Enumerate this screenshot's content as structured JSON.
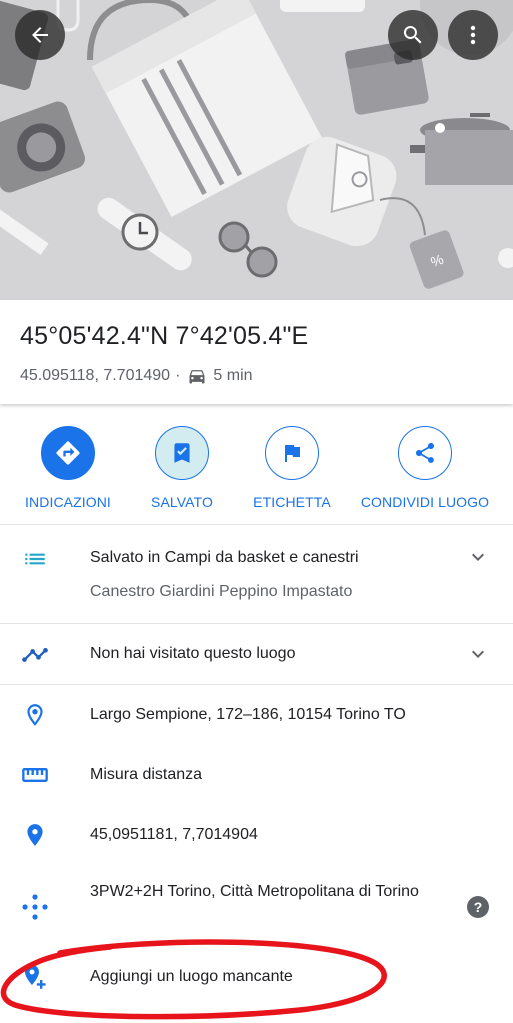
{
  "header": {
    "back_icon": "arrow-left-icon",
    "search_icon": "search-icon",
    "more_icon": "more-vert-icon"
  },
  "place": {
    "title": "45°05'42.4\"N 7°42'05.4\"E",
    "coords": "45.095118, 7.701490",
    "separator": "·",
    "travel_time": "5 min"
  },
  "actions": [
    {
      "label": "INDICAZIONI",
      "icon": "directions-icon"
    },
    {
      "label": "SALVATO",
      "icon": "bookmark-check-icon"
    },
    {
      "label": "ETICHETTA",
      "icon": "flag-icon"
    },
    {
      "label": "CONDIVIDI LUOGO",
      "icon": "share-icon"
    }
  ],
  "details": {
    "saved_list": "Salvato in Campi da basket e canestri",
    "saved_note": "Canestro Giardini Peppino Impastato",
    "visited": "Non hai visitato questo luogo",
    "address": "Largo Sempione, 172–186, 10154 Torino TO",
    "measure": "Misura distanza",
    "decimal_coords": "45,0951181, 7,7014904",
    "plus_code": "3PW2+2H Torino, Città Metropolitana di Torino",
    "help": "?",
    "add_place": "Aggiungi un luogo mancante"
  },
  "colors": {
    "accent": "#1a73e8",
    "annotation": "#e8141c"
  }
}
